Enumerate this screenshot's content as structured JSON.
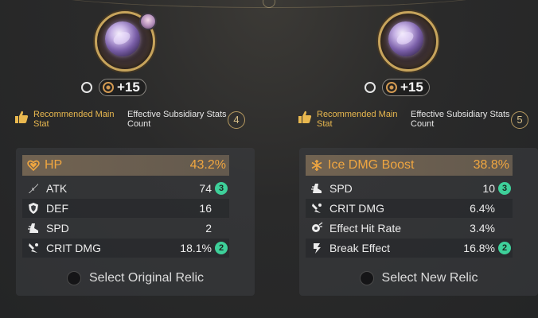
{
  "left": {
    "level": "+15",
    "recommended_label": "Recommended Main Stat",
    "subsidiary_label": "Effective Subsidiary Stats Count",
    "subsidiary_count": "4",
    "main_stat": {
      "name": "HP",
      "value": "43.2%",
      "icon": "heart-icon"
    },
    "sub_stats": [
      {
        "name": "ATK",
        "value": "74",
        "rolls": "3",
        "icon": "sword-icon"
      },
      {
        "name": "DEF",
        "value": "16",
        "rolls": "",
        "icon": "shield-icon"
      },
      {
        "name": "SPD",
        "value": "2",
        "rolls": "",
        "icon": "boot-icon"
      },
      {
        "name": "CRIT DMG",
        "value": "18.1%",
        "rolls": "2",
        "icon": "crit-icon"
      }
    ],
    "select_label": "Select Original Relic"
  },
  "right": {
    "level": "+15",
    "recommended_label": "Recommended Main Stat",
    "subsidiary_label": "Effective Subsidiary Stats Count",
    "subsidiary_count": "5",
    "main_stat": {
      "name": "Ice DMG Boost",
      "value": "38.8%",
      "icon": "snowflake-icon"
    },
    "sub_stats": [
      {
        "name": "SPD",
        "value": "10",
        "rolls": "3",
        "icon": "boot-icon"
      },
      {
        "name": "CRIT DMG",
        "value": "6.4%",
        "rolls": "",
        "icon": "crit-icon"
      },
      {
        "name": "Effect Hit Rate",
        "value": "3.4%",
        "rolls": "",
        "icon": "hit-rate-icon"
      },
      {
        "name": "Break Effect",
        "value": "16.8%",
        "rolls": "2",
        "icon": "break-icon"
      }
    ],
    "select_label": "Select New Relic"
  },
  "colors": {
    "accent_gold": "#f0a640",
    "roll_green": "#3ed09a",
    "rec_yellow": "#e9b84f"
  }
}
